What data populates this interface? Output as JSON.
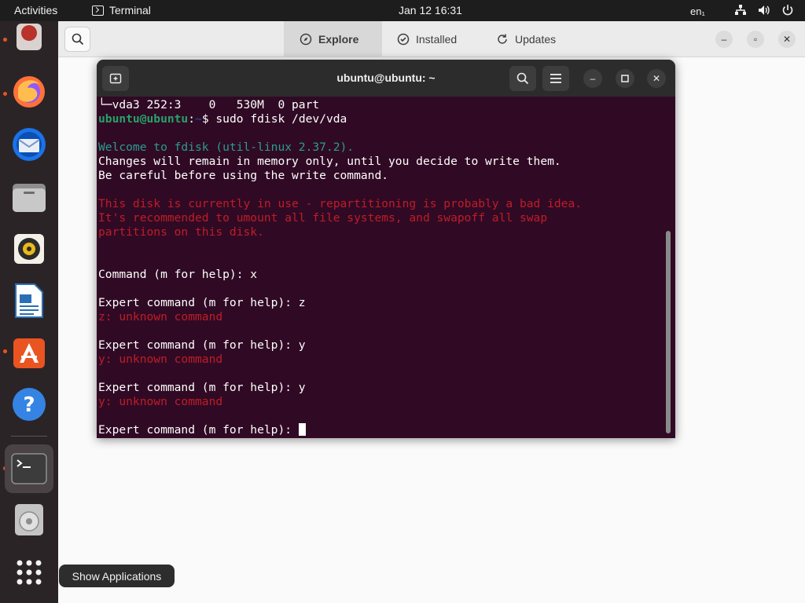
{
  "topbar": {
    "activities": "Activities",
    "app_name": "Terminal",
    "clock": "Jan 12  16:31",
    "lang": "en₁",
    "icons": [
      "network-icon",
      "volume-icon",
      "power-icon"
    ]
  },
  "dock": {
    "items": [
      {
        "name": "dock-item-files-cabinet",
        "icon": "partial-app-icon",
        "running": true
      },
      {
        "name": "dock-item-firefox",
        "icon": "firefox-icon",
        "running": true
      },
      {
        "name": "dock-item-thunderbird",
        "icon": "thunderbird-icon",
        "running": false
      },
      {
        "name": "dock-item-files",
        "icon": "files-icon",
        "running": false
      },
      {
        "name": "dock-item-rhythmbox",
        "icon": "rhythmbox-icon",
        "running": false
      },
      {
        "name": "dock-item-writer",
        "icon": "libreoffice-writer-icon",
        "running": false
      },
      {
        "name": "dock-item-software",
        "icon": "ubuntu-software-icon",
        "running": true
      },
      {
        "name": "dock-item-help",
        "icon": "help-icon",
        "running": false
      },
      {
        "name": "dock-item-terminal",
        "icon": "terminal-icon",
        "running": true
      },
      {
        "name": "dock-item-disc",
        "icon": "disc-icon",
        "running": false
      },
      {
        "name": "dock-item-show-apps",
        "icon": "app-grid-icon",
        "running": false
      }
    ]
  },
  "software": {
    "tabs": [
      {
        "label": "Explore",
        "icon": "compass-icon",
        "selected": true
      },
      {
        "label": "Installed",
        "icon": "check-circle-icon",
        "selected": false
      },
      {
        "label": "Updates",
        "icon": "refresh-icon",
        "selected": false
      }
    ]
  },
  "terminal": {
    "title": "ubuntu@ubuntu: ~",
    "lines": [
      {
        "segments": [
          {
            "text": "└─vda3 252:3    0   530M  0 part",
            "style": "normal"
          }
        ]
      },
      {
        "segments": [
          {
            "text": "ubuntu@ubuntu",
            "style": "green"
          },
          {
            "text": ":",
            "style": "normal"
          },
          {
            "text": "~",
            "style": "blue"
          },
          {
            "text": "$ sudo fdisk /dev/vda",
            "style": "normal"
          }
        ]
      },
      {
        "segments": []
      },
      {
        "segments": [
          {
            "text": "Welcome to fdisk (util-linux 2.37.2).",
            "style": "teal"
          }
        ]
      },
      {
        "segments": [
          {
            "text": "Changes will remain in memory only, until you decide to write them.",
            "style": "normal"
          }
        ]
      },
      {
        "segments": [
          {
            "text": "Be careful before using the write command.",
            "style": "normal"
          }
        ]
      },
      {
        "segments": []
      },
      {
        "segments": [
          {
            "text": "This disk is currently in use - repartitioning is probably a bad idea.",
            "style": "red"
          }
        ]
      },
      {
        "segments": [
          {
            "text": "It's recommended to umount all file systems, and swapoff all swap",
            "style": "red"
          }
        ]
      },
      {
        "segments": [
          {
            "text": "partitions on this disk.",
            "style": "red"
          }
        ]
      },
      {
        "segments": []
      },
      {
        "segments": []
      },
      {
        "segments": [
          {
            "text": "Command (m for help): x",
            "style": "normal"
          }
        ]
      },
      {
        "segments": []
      },
      {
        "segments": [
          {
            "text": "Expert command (m for help): z",
            "style": "normal"
          }
        ]
      },
      {
        "segments": [
          {
            "text": "z: unknown command",
            "style": "red"
          }
        ]
      },
      {
        "segments": []
      },
      {
        "segments": [
          {
            "text": "Expert command (m for help): y",
            "style": "normal"
          }
        ]
      },
      {
        "segments": [
          {
            "text": "y: unknown command",
            "style": "red"
          }
        ]
      },
      {
        "segments": []
      },
      {
        "segments": [
          {
            "text": "Expert command (m for help): y",
            "style": "normal"
          }
        ]
      },
      {
        "segments": [
          {
            "text": "y: unknown command",
            "style": "red"
          }
        ]
      },
      {
        "segments": []
      },
      {
        "segments": [
          {
            "text": "Expert command (m for help): ",
            "style": "normal"
          }
        ],
        "cursor": true
      }
    ]
  },
  "tooltip": {
    "label": "Show Applications"
  },
  "colors": {
    "terminal_bg": "#300a24",
    "prompt_user": "#26a269",
    "prompt_path": "#12488b",
    "error_red": "#c01c28",
    "info_teal": "#2a9d8f",
    "accent": "#e95420"
  }
}
